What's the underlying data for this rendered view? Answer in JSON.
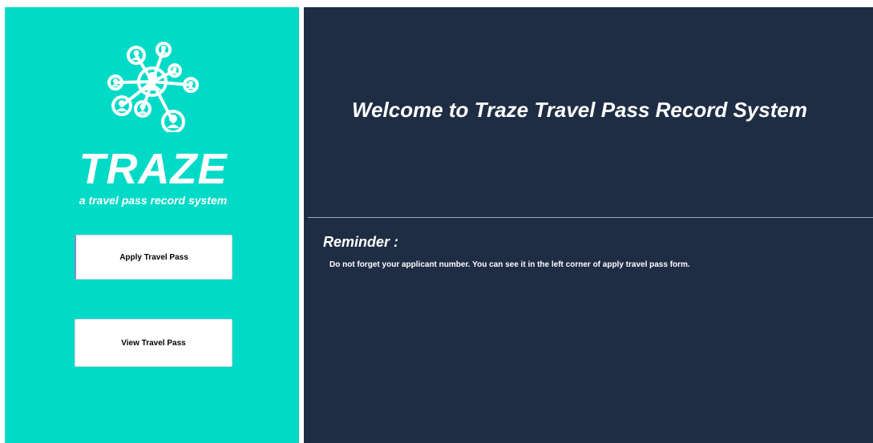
{
  "sidebar": {
    "logo_icon": "network-people-icon",
    "brand_title": "TRAZE",
    "tagline": "a travel pass record system",
    "buttons": {
      "apply_label": "Apply Travel Pass",
      "view_label": "View Travel Pass"
    }
  },
  "main": {
    "welcome_title": "Welcome to Traze Travel Pass Record System",
    "reminder_title": "Reminder :",
    "reminder_text": "Do not forget your applicant number. You can see it in the left corner of apply travel pass form."
  },
  "colors": {
    "sidebar_bg": "#00dac7",
    "main_bg": "#1f2d44",
    "text": "#ffffff"
  }
}
